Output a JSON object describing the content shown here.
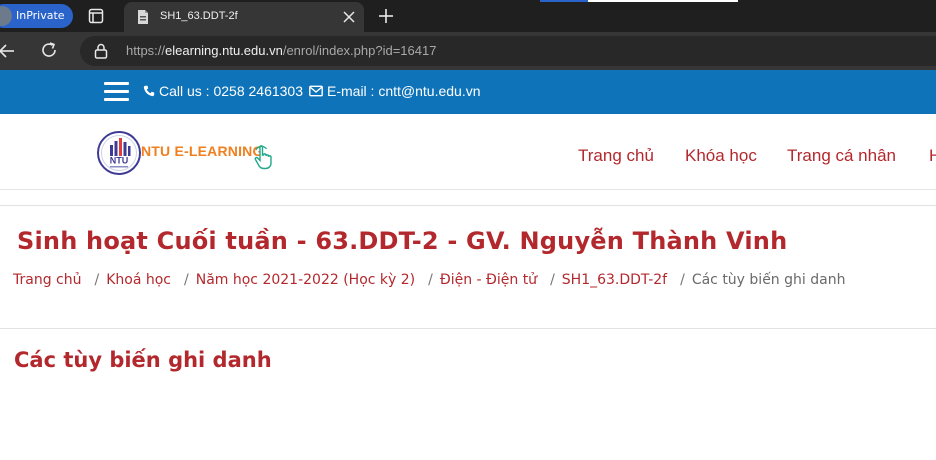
{
  "browser": {
    "inprivate_label": "InPrivate",
    "tab_title": "SH1_63.DDT-2f",
    "url_prefix": "https://",
    "url_host": "elearning.ntu.edu.vn",
    "url_path": "/enrol/index.php?id=16417",
    "accent_color": "#2a63c9"
  },
  "infobar": {
    "call_text": "Call us : 0258 2461303",
    "email_text": "E-mail : cntt@ntu.edu.vn",
    "background": "#0e73b8"
  },
  "header": {
    "logo_badge": "NTU",
    "logo_text": "NTU E-LEARNING",
    "nav": [
      {
        "label": "Trang chủ"
      },
      {
        "label": "Khóa học"
      },
      {
        "label": "Trang cá nhân"
      },
      {
        "label": "H"
      }
    ]
  },
  "page": {
    "title": "Sinh hoạt Cuối tuần - 63.DDT-2 - GV. Nguyễn Thành Vinh",
    "breadcrumb": [
      {
        "label": "Trang chủ"
      },
      {
        "label": "Khoá học"
      },
      {
        "label": "Năm học 2021-2022 (Học kỳ 2)"
      },
      {
        "label": "Điện - Điện tử"
      },
      {
        "label": "SH1_63.DDT-2f"
      },
      {
        "label": "Các tùy biến ghi danh"
      }
    ],
    "breadcrumb_separator": "/",
    "section_title": "Các tùy biến ghi danh",
    "accent_color": "#b3282d"
  }
}
